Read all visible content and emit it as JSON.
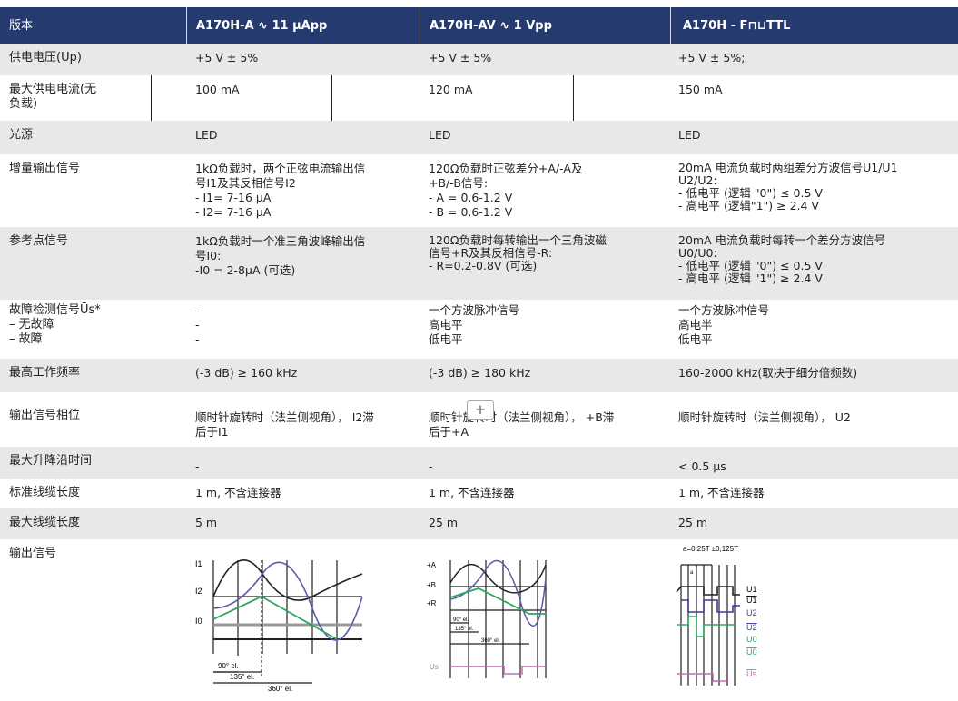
{
  "header": {
    "label": "版本",
    "col1": "A170H-A ∿ 11 µApp",
    "col2": "A170H-AV ∿ 1 Vpp",
    "col3": "A170H - F⊓⊔TTL"
  },
  "rows": [
    {
      "label": "供电电压(Up)",
      "v1": "+5 V ± 5%",
      "v2": "+5 V ± 5%",
      "v3": "+5 V ± 5%;"
    },
    {
      "label": "最大供电电流(无\n负载)",
      "v1": "100 mA",
      "v2": "120 mA",
      "v3": "150 mA"
    },
    {
      "label": "光源",
      "v1": "LED",
      "v2": "LED",
      "v3": "LED"
    },
    {
      "label": "增量输出信号",
      "v1": "1kΩ负载时，两个正弦电流输出信\n号I1及其反相信号I2\n - I1= 7-16 µA\n - I2= 7-16 µA",
      "v2": "120Ω负载时正弦差分+A/-A及\n+B/-B信号:\n- A = 0.6-1.2 V\n- B = 0.6-1.2 V",
      "v3": "20mA 电流负载时两组差分方波信号U1/U1\nU2/U2:\n- 低电平 (逻辑 \"0\") ≤ 0.5 V\n- 高电平 (逻辑\"1\") ≥ 2.4 V"
    },
    {
      "label": "参考点信号",
      "v1": "1kΩ负载时一个准三角波峰输出信\n号I0:\n-I0 = 2-8µA (可选)",
      "v2": "120Ω负载时每转输出一个三角波磁\n信号+R及其反相信号-R:\n- R=0.2-0.8V (可选)",
      "v3": "20mA 电流负载时每转一个差分方波信号\nU0/U0:\n- 低电平 (逻辑 \"0\") ≤ 0.5 V\n- 高电平 (逻辑 \"1\") ≥ 2.4 V"
    },
    {
      "label": "故障检测信号Ūs*\n–  无故障\n–  故障",
      "v1": "-\n-\n-",
      "v2": "一个方波脉冲信号\n高电平\n低电平",
      "v3": "一个方波脉冲信号\n高电半\n低电平"
    },
    {
      "label": "最高工作频率",
      "v1": "(-3 dB) ≥ 160 kHz",
      "v2": "(-3 dB) ≥ 180 kHz",
      "v3": "160-2000 kHz(取决于细分倍频数)"
    },
    {
      "label": "输出信号相位",
      "v1": "顺时针旋转时（法兰侧视角），  I2滞\n后于I1",
      "v2": "顺时针旋转时（法兰侧视角），  +B滞\n后于+A",
      "v3": "顺时针旋转时（法兰侧视角），  U2"
    },
    {
      "label": "最大升降沿时间",
      "v1": "-",
      "v2": "-",
      "v3": "< 0.5 µs"
    },
    {
      "label": "标准线缆长度",
      "v1": "1 m, 不含连接器",
      "v2": "1 m, 不含连接器",
      "v3": "1 m, 不含连接器"
    },
    {
      "label": "最大线缆长度",
      "v1": "5 m",
      "v2": "25 m",
      "v3": "25 m"
    },
    {
      "label": "输出信号"
    }
  ],
  "diagrams": {
    "d1": {
      "labels": [
        "I1",
        "I2",
        "I0"
      ],
      "dims": [
        "90° el.",
        "135° el.",
        "360° el."
      ]
    },
    "d2": {
      "labels": [
        "+A",
        "+B",
        "+R",
        "Us"
      ],
      "dims": [
        "90° el.",
        "135° el.",
        "360° el."
      ]
    },
    "d3": {
      "title": "a=0,25T ±0,125T",
      "labels": [
        "U1",
        "U1",
        "U2",
        "U2",
        "U0",
        "U0",
        "Us"
      ],
      "a": "a"
    }
  },
  "overlay": {
    "plus": "+"
  },
  "colors": {
    "header_bg": "#253a6e",
    "row_alt": "#e8e8e8",
    "sine1": "#222222",
    "sine2": "#5a5aa8",
    "ref": "#2aa860",
    "fault": "#c070b0"
  }
}
